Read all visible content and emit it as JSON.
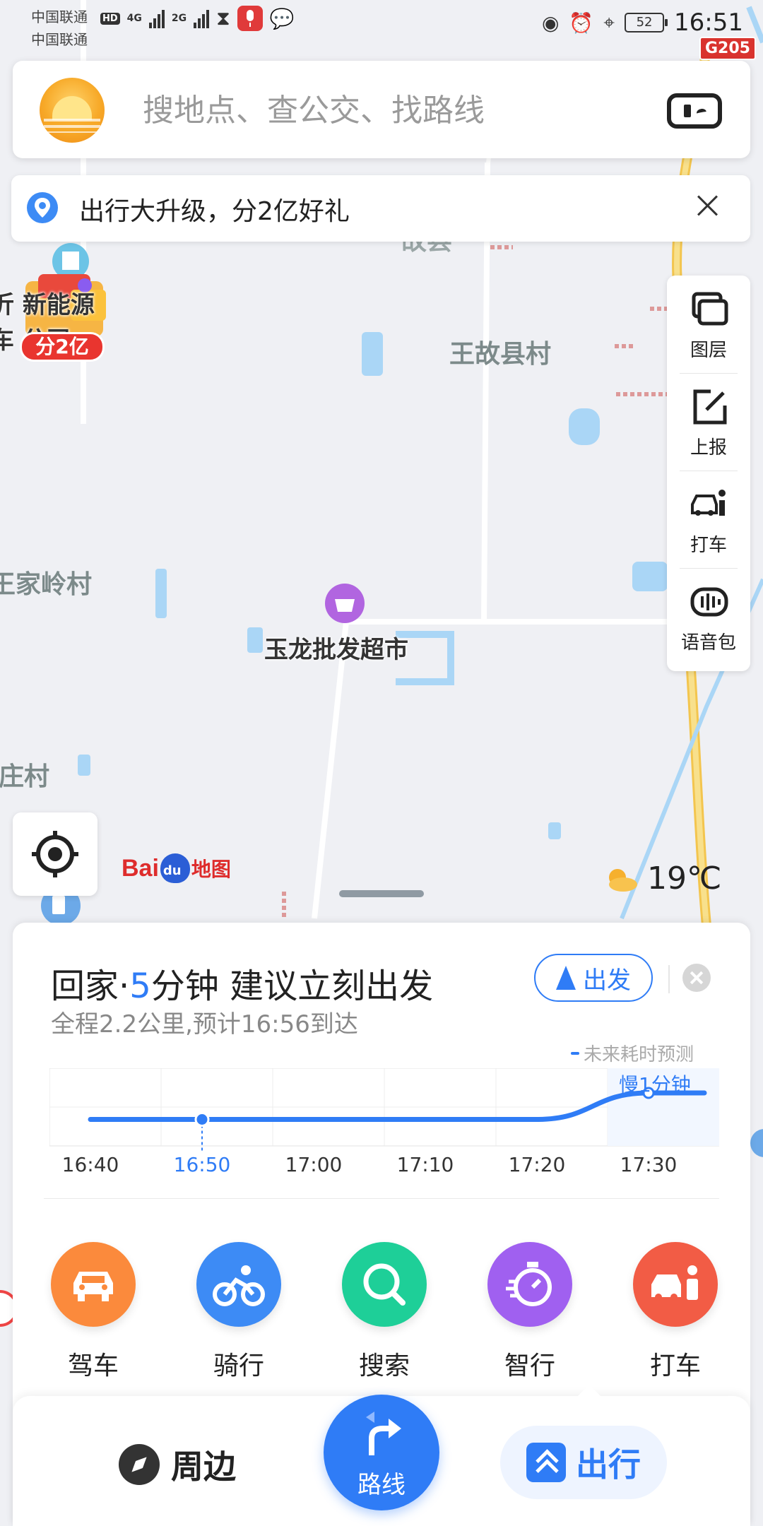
{
  "status_bar": {
    "carrier_1": "中国联通",
    "carrier_2": "中国联通",
    "hd": "HD",
    "net_1": "4G",
    "net_2": "2G",
    "battery": "52",
    "time": "16:51"
  },
  "map": {
    "highway_badge": "G205",
    "labels": {
      "wangguxian": "王故县村",
      "wangjialing": "王家岭村",
      "zhuangcun": "庄村",
      "energy_1": "沂  新能源",
      "energy_2": "车  公司",
      "supermarket": "玉龙批发超市",
      "partial_top": "故县"
    },
    "promo_badge": "分2亿",
    "logo": {
      "bai": "Bai",
      "du": "du",
      "map": "地图"
    },
    "weather": {
      "temp": "19℃",
      "icon": "partly-cloudy-icon"
    },
    "colors": {
      "water": "#aad6f6",
      "road": "#ffffff",
      "highway": "#f6cc55",
      "accent": "#2f7cf6"
    }
  },
  "search": {
    "placeholder": "搜地点、查公交、找路线"
  },
  "promo": {
    "text": "出行大升级，分2亿好礼"
  },
  "tools": [
    {
      "label": "图层",
      "icon": "layers-icon"
    },
    {
      "label": "上报",
      "icon": "report-icon"
    },
    {
      "label": "打车",
      "icon": "taxi-icon"
    },
    {
      "label": "语音包",
      "icon": "voice-pack-icon"
    }
  ],
  "commute": {
    "title_prefix": "回家·",
    "minutes": "5",
    "title_suffix": "分钟 建议立刻出发",
    "subtitle": "全程2.2公里,预计16:56到达",
    "go_label": "出发",
    "forecast_legend": "未来耗时预测",
    "slow_note": "慢1分钟"
  },
  "chart_data": {
    "type": "line",
    "title": "",
    "xlabel": "",
    "ylabel": "",
    "categories": [
      "16:40",
      "16:50",
      "17:00",
      "17:10",
      "17:20",
      "17:30"
    ],
    "x": [
      "16:40",
      "16:50",
      "17:00",
      "17:10",
      "17:20",
      "17:30",
      "17:35"
    ],
    "series": [
      {
        "name": "",
        "values": [
          5,
          5,
          5,
          5,
          5,
          6,
          6
        ]
      }
    ],
    "current_time": "16:50",
    "ylim": [
      4,
      7
    ],
    "grid": true
  },
  "modes": [
    {
      "label": "驾车",
      "icon": "car-icon",
      "color": "#fb8a3c"
    },
    {
      "label": "骑行",
      "icon": "bike-icon",
      "color": "#3d8bf5"
    },
    {
      "label": "搜索",
      "icon": "search-icon",
      "color": "#1ecf98"
    },
    {
      "label": "智行",
      "icon": "stopwatch-icon",
      "color": "#a060f0"
    },
    {
      "label": "打车",
      "icon": "taxi-icon",
      "color": "#f25c45"
    }
  ],
  "nav": {
    "nearby": "周边",
    "route": "路线",
    "travel": "出行"
  }
}
